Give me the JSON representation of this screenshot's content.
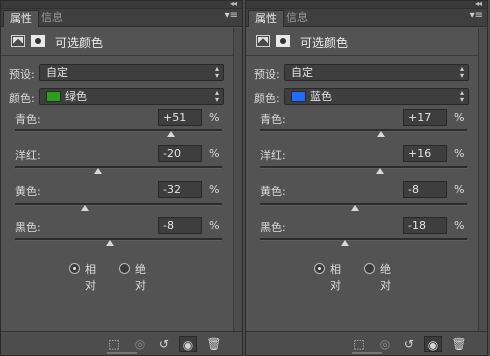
{
  "panels": [
    {
      "tabs": [
        "属性",
        "信息"
      ],
      "title": "可选颜色",
      "preset_label": "预设:",
      "preset_value": "自定",
      "colors_label": "颜色:",
      "color_value": "绿色",
      "color_swatch": "#2e9e1e",
      "sliders": [
        {
          "label": "青色:",
          "value": "+51",
          "unit": "%",
          "level": 0.755
        },
        {
          "label": "洋红:",
          "value": "-20",
          "unit": "%",
          "level": 0.4
        },
        {
          "label": "黄色:",
          "value": "-32",
          "unit": "%",
          "level": 0.34
        },
        {
          "label": "黑色:",
          "value": "-8",
          "unit": "%",
          "level": 0.46
        }
      ],
      "method": {
        "relative": "相对",
        "absolute": "绝对",
        "selected": "relative"
      }
    },
    {
      "tabs": [
        "属性",
        "信息"
      ],
      "title": "可选颜色",
      "preset_label": "预设:",
      "preset_value": "自定",
      "colors_label": "颜色:",
      "color_value": "蓝色",
      "color_swatch": "#1f6bff",
      "sliders": [
        {
          "label": "青色:",
          "value": "+17",
          "unit": "%",
          "level": 0.585
        },
        {
          "label": "洋红:",
          "value": "+16",
          "unit": "%",
          "level": 0.58
        },
        {
          "label": "黄色:",
          "value": "-8",
          "unit": "%",
          "level": 0.46
        },
        {
          "label": "黑色:",
          "value": "-18",
          "unit": "%",
          "level": 0.41
        }
      ],
      "method": {
        "relative": "相对",
        "absolute": "绝对",
        "selected": "relative"
      }
    }
  ],
  "icons": {
    "collapse": "double-chevron-left-icon",
    "panel_menu": "panel-menu-icon",
    "adjustment": "selective-color-icon",
    "mask": "layer-mask-icon",
    "footer": [
      "clip-to-layer-icon",
      "view-previous-state-icon",
      "reset-icon",
      "visibility-eye-icon",
      "trash-icon"
    ]
  }
}
